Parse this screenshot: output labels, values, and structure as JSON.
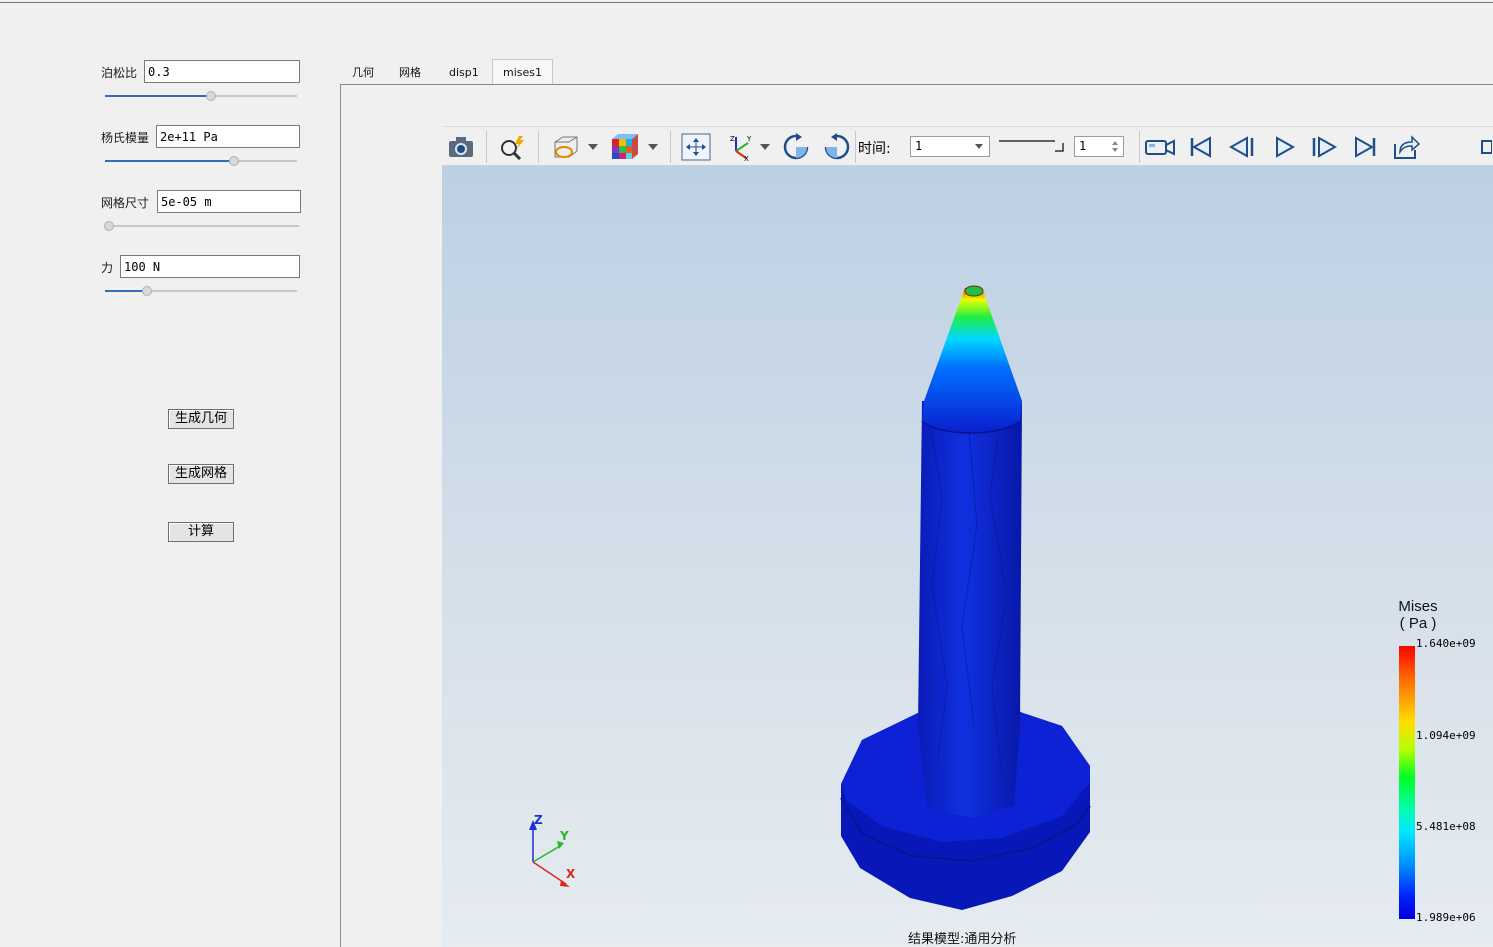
{
  "params": [
    {
      "label": "泊松比",
      "value": "0.3",
      "slider_fraction": 0.55
    },
    {
      "label": "杨氏模量",
      "value": "2e+11 Pa",
      "slider_fraction": 0.67
    },
    {
      "label": "网格尺寸",
      "value": "5e-05 m",
      "slider_fraction": 0.0
    },
    {
      "label": "力",
      "value": "100 N",
      "slider_fraction": 0.22
    }
  ],
  "actions": {
    "gen_geometry": "生成几何",
    "gen_mesh": "生成网格",
    "compute": "计算"
  },
  "tabs": [
    "几何",
    "网格",
    "disp1",
    "mises1"
  ],
  "active_tab": "mises1",
  "toolbar": {
    "time_label": "时间:",
    "time_value": "1",
    "frame_value": "1",
    "icons": [
      "camera-icon",
      "zoom-fit-icon",
      "display-mode-icon",
      "color-cube-icon",
      "pan-icon",
      "axes-icon",
      "rotate-cw-icon",
      "rotate-ccw-icon",
      "record-video-icon",
      "first-frame-icon",
      "prev-frame-icon",
      "play-icon",
      "next-frame-icon",
      "last-frame-icon",
      "export-icon"
    ]
  },
  "legend": {
    "title_line1": "Mises",
    "title_line2": "( Pa )",
    "max": "1.640e+09",
    "mid_high": "1.094e+09",
    "mid_low": "5.481e+08",
    "min": "1.989e+06"
  },
  "axes": {
    "z": "Z",
    "y": "Y",
    "x": "X"
  },
  "caption": "结果模型:通用分析",
  "colors": {
    "accent": "#2f6fb5",
    "model": "#0a1fd0",
    "axis_x": "#e0241b",
    "axis_y": "#2bb52b",
    "axis_z": "#1c2fd6"
  }
}
